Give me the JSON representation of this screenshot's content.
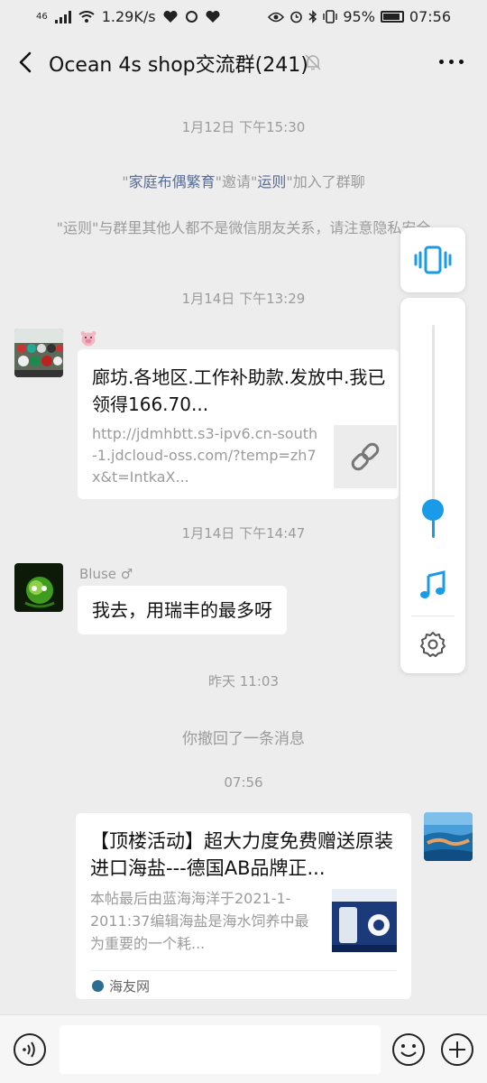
{
  "status_bar": {
    "network": "46",
    "speed": "1.29K/s",
    "battery": "95%",
    "time": "07:56"
  },
  "header": {
    "title": "Ocean 4s shop交流群(241)"
  },
  "messages": {
    "ts1": "1月12日 下午15:30",
    "sys1": {
      "part1": "\"",
      "inviter": "家庭布偶繁育",
      "part2": "\"邀请\"",
      "invitee": "运则",
      "part3": "\"加入了群聊"
    },
    "sys2": "\"运则\"与群里其他人都不是微信朋友关系，请注意隐私安全",
    "ts2": "1月14日 下午13:29",
    "link_msg": {
      "title": "廊坊.各地区.工作补助款.发放中.我已领得166.70...",
      "url": "http://jdmhbtt.s3-ipv6.cn-south-1.jdcloud-oss.com/?temp=zh7x&t=IntkaX..."
    },
    "ts3": "1月14日 下午14:47",
    "sender_bluse": "Bluse ♂",
    "text_msg": "我去，用瑞丰的最多呀",
    "ts4": "昨天 11:03",
    "recalled": "你撤回了一条消息",
    "ts5": "07:56",
    "article": {
      "title": "【顶楼活动】超大力度免费赠送原装进口海盐---德国AB品牌正...",
      "desc": "本帖最后由蓝海海洋于2021-1-2011:37编辑海盐是海水饲养中最为重要的一个耗...",
      "source": "海友网"
    }
  },
  "volume": {
    "level": 0.13
  },
  "input": {
    "value": ""
  },
  "colors": {
    "accent_blue": "#1a9be8",
    "name_link": "#576b95",
    "background": "#ededed"
  }
}
